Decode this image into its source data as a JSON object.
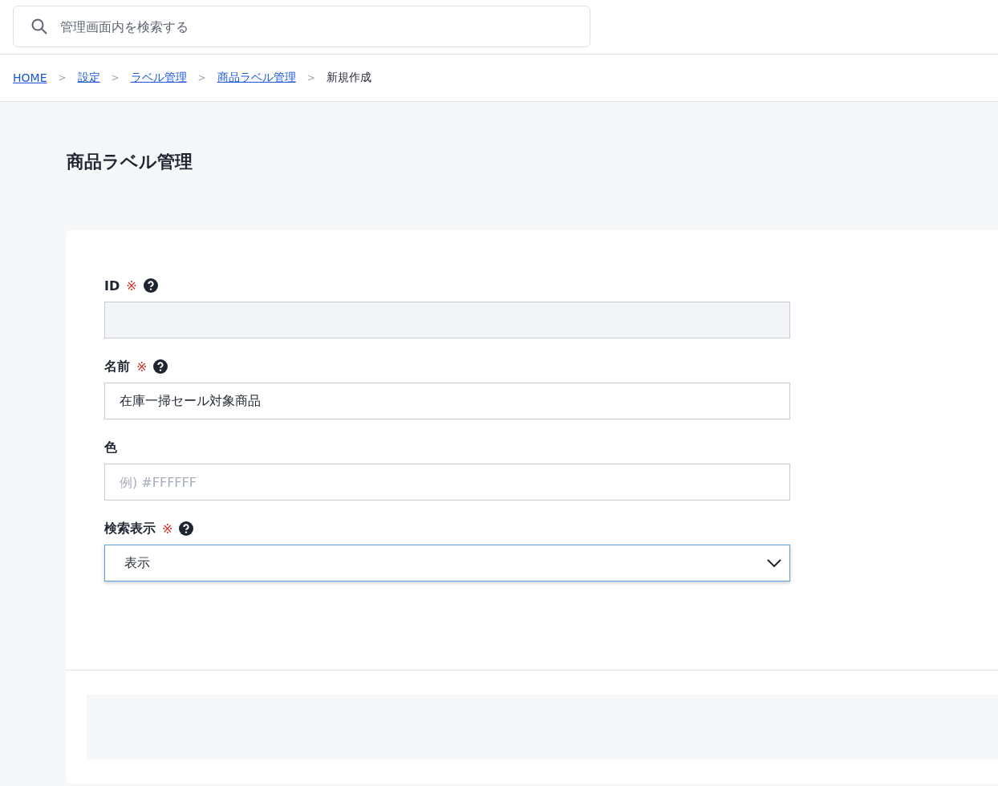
{
  "search": {
    "placeholder": "管理画面内を検索する"
  },
  "breadcrumb": [
    {
      "label": "HOME",
      "link": true
    },
    {
      "label": "設定",
      "link": true
    },
    {
      "label": "ラベル管理",
      "link": true
    },
    {
      "label": "商品ラベル管理",
      "link": true
    },
    {
      "label": "新規作成",
      "link": false
    }
  ],
  "breadcrumb_separator": ">",
  "page_title": "商品ラベル管理",
  "fields": [
    {
      "kind": "input",
      "label": "ID",
      "required_mark": "※",
      "help": true,
      "disabled": true
    },
    {
      "kind": "input",
      "label": "名前",
      "required_mark": "※",
      "help": true,
      "disabled": false,
      "value": "在庫一掃セール対象商品"
    },
    {
      "kind": "input",
      "label": "色",
      "help": false,
      "disabled": false,
      "placeholder": "例) #FFFFFF"
    },
    {
      "kind": "select",
      "label": "検索表示",
      "required_mark": "※",
      "help": true,
      "focused": true,
      "value": "表示"
    }
  ]
}
